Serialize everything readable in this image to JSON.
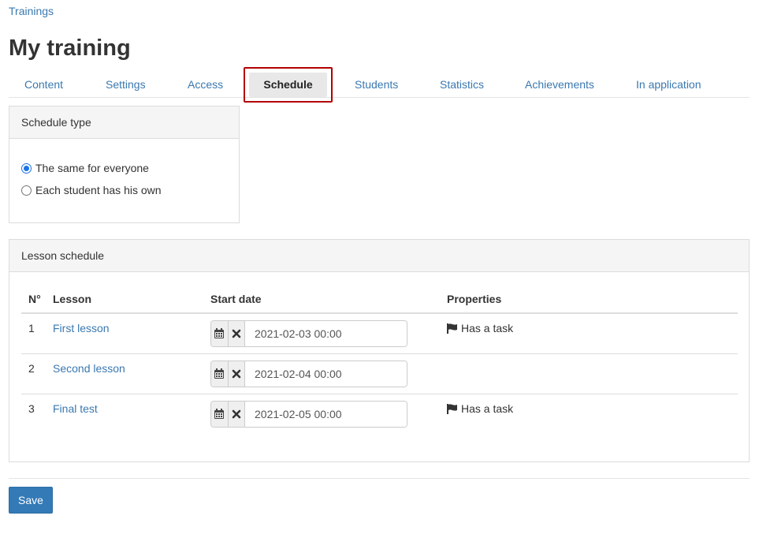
{
  "breadcrumb": {
    "label": "Trainings"
  },
  "page": {
    "title": "My training"
  },
  "tabs": [
    {
      "label": "Content"
    },
    {
      "label": "Settings"
    },
    {
      "label": "Access"
    },
    {
      "label": "Schedule",
      "active": true
    },
    {
      "label": "Students"
    },
    {
      "label": "Statistics"
    },
    {
      "label": "Achievements"
    },
    {
      "label": "In application"
    }
  ],
  "schedule_type": {
    "heading": "Schedule type",
    "options": [
      {
        "label": "The same for everyone",
        "checked": true
      },
      {
        "label": "Each student has his own",
        "checked": false
      }
    ]
  },
  "lesson_schedule": {
    "heading": "Lesson schedule",
    "columns": {
      "num": "N°",
      "lesson": "Lesson",
      "start_date": "Start date",
      "properties": "Properties"
    },
    "rows": [
      {
        "num": "1",
        "lesson": "First lesson",
        "start_date": "2021-02-03 00:00",
        "property": "Has a task"
      },
      {
        "num": "2",
        "lesson": "Second lesson",
        "start_date": "2021-02-04 00:00",
        "property": ""
      },
      {
        "num": "3",
        "lesson": "Final test",
        "start_date": "2021-02-05 00:00",
        "property": "Has a task"
      }
    ]
  },
  "actions": {
    "save_label": "Save"
  },
  "colors": {
    "link": "#3a78b0",
    "primary_button": "#337ab7",
    "highlight_border": "#b40000"
  },
  "icons": {
    "calendar": "calendar-icon",
    "clear": "close-icon",
    "task": "flag-icon"
  }
}
